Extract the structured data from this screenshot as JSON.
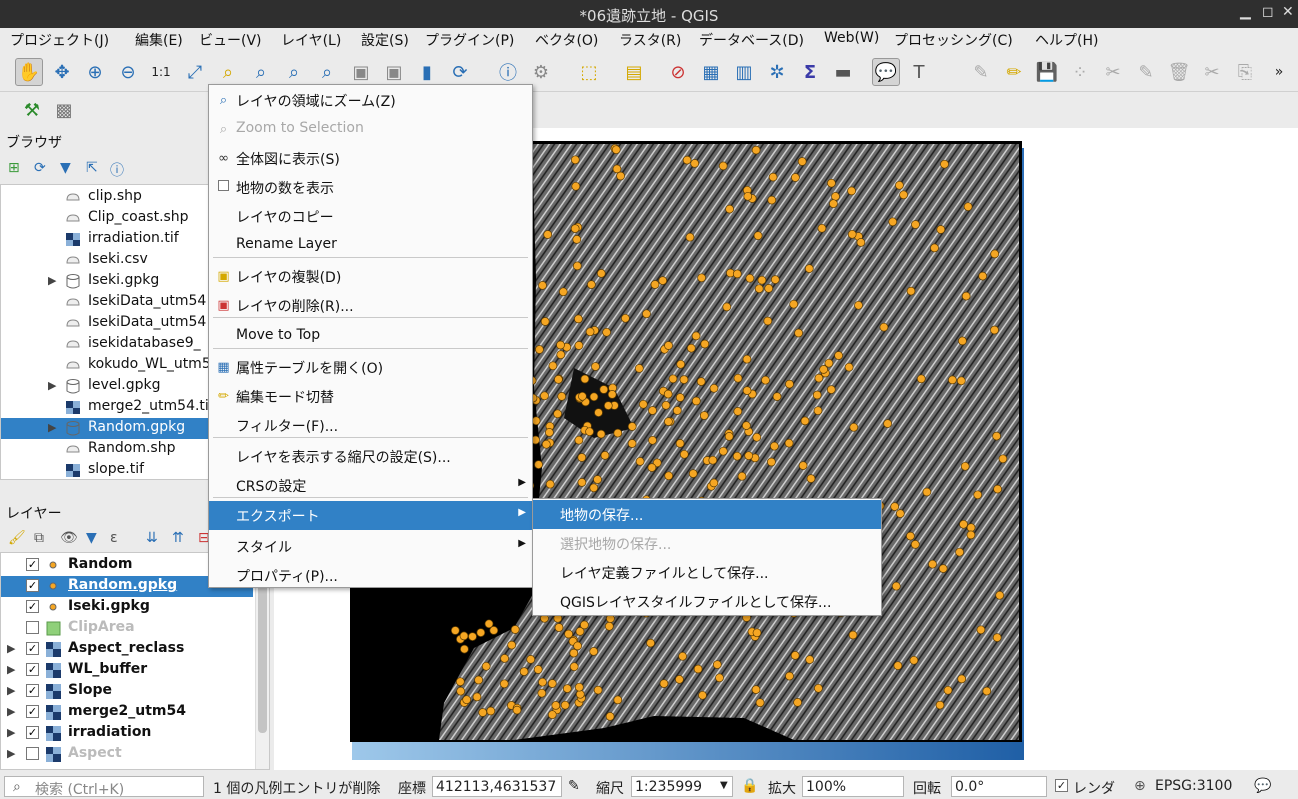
{
  "window": {
    "title": "*06遺跡立地 - QGIS"
  },
  "menu": [
    "プロジェクト(J)",
    "編集(E)",
    "ビュー(V)",
    "レイヤ(L)",
    "設定(S)",
    "プラグイン(P)",
    "ベクタ(O)",
    "ラスタ(R)",
    "データベース(D)",
    "Web(W)",
    "プロセッシング(C)",
    "ヘルプ(H)"
  ],
  "browser": {
    "title": "ブラウザ",
    "items": [
      {
        "label": "clip.shp",
        "icon": "vector-file-icon"
      },
      {
        "label": "Clip_coast.shp",
        "icon": "vector-file-icon"
      },
      {
        "label": "irradiation.tif",
        "icon": "raster-file-icon"
      },
      {
        "label": "Iseki.csv",
        "icon": "vector-file-icon"
      },
      {
        "label": "Iseki.gpkg",
        "icon": "geopackage-icon"
      },
      {
        "label": "IsekiData_utm54",
        "icon": "vector-file-icon"
      },
      {
        "label": "IsekiData_utm54",
        "icon": "vector-file-icon"
      },
      {
        "label": "isekidatabase9_",
        "icon": "vector-file-icon"
      },
      {
        "label": "kokudo_WL_utm5",
        "icon": "vector-file-icon"
      },
      {
        "label": "level.gpkg",
        "icon": "geopackage-icon"
      },
      {
        "label": "merge2_utm54.ti",
        "icon": "raster-file-icon"
      },
      {
        "label": "Random.gpkg",
        "icon": "geopackage-icon"
      },
      {
        "label": "Random.shp",
        "icon": "vector-file-icon"
      },
      {
        "label": "slope.tif",
        "icon": "raster-file-icon"
      }
    ]
  },
  "layers": {
    "title": "レイヤー",
    "items": [
      {
        "label": "Random",
        "checked": true
      },
      {
        "label": "Random.gpkg",
        "checked": true
      },
      {
        "label": "Iseki.gpkg",
        "checked": true
      },
      {
        "label": "ClipArea",
        "checked": false
      },
      {
        "label": "Aspect_reclass",
        "checked": true
      },
      {
        "label": "WL_buffer",
        "checked": true
      },
      {
        "label": "Slope",
        "checked": true
      },
      {
        "label": "merge2_utm54",
        "checked": true
      },
      {
        "label": "irradiation",
        "checked": true
      },
      {
        "label": "Aspect",
        "checked": false
      }
    ]
  },
  "context_menu": [
    {
      "label": "レイヤの領域にズーム(Z)",
      "icon": "zoom-layer-icon",
      "disabled": false
    },
    {
      "label": "Zoom to Selection",
      "icon": "zoom-selection-icon",
      "disabled": true
    },
    {
      "label": "全体図に表示(S)",
      "icon": "overview-icon",
      "disabled": false
    },
    {
      "label": "地物の数を表示",
      "icon": "checkbox-icon",
      "disabled": false
    },
    {
      "label": "レイヤのコピー",
      "icon": "",
      "disabled": false
    },
    {
      "label": "Rename Layer",
      "icon": "",
      "disabled": false
    },
    {
      "label": "レイヤの複製(D)",
      "icon": "duplicate-icon",
      "disabled": false
    },
    {
      "label": "レイヤの削除(R)...",
      "icon": "remove-layer-icon",
      "disabled": false
    },
    {
      "label": "Move to Top",
      "icon": "",
      "disabled": false
    },
    {
      "label": "属性テーブルを開く(O)",
      "icon": "table-icon",
      "disabled": false
    },
    {
      "label": "編集モード切替",
      "icon": "pencil-icon",
      "disabled": false
    },
    {
      "label": "フィルター(F)...",
      "icon": "",
      "disabled": false
    },
    {
      "label": "レイヤを表示する縮尺の設定(S)...",
      "icon": "",
      "disabled": false
    },
    {
      "label": "CRSの設定",
      "icon": "",
      "disabled": false,
      "submenu": true
    },
    {
      "label": "エクスポート",
      "icon": "",
      "disabled": false,
      "submenu": true,
      "highlighted": true
    },
    {
      "label": "スタイル",
      "icon": "",
      "disabled": false,
      "submenu": true
    },
    {
      "label": "プロパティ(P)...",
      "icon": "",
      "disabled": false
    }
  ],
  "export_submenu": [
    {
      "label": "地物の保存...",
      "highlighted": true,
      "disabled": false
    },
    {
      "label": "選択地物の保存...",
      "highlighted": false,
      "disabled": true
    },
    {
      "label": "レイヤ定義ファイルとして保存...",
      "highlighted": false,
      "disabled": false
    },
    {
      "label": "QGISレイヤスタイルファイルとして保存...",
      "highlighted": false,
      "disabled": false
    }
  ],
  "status": {
    "search_placeholder": "検索 (Ctrl+K)",
    "message": "1 個の凡例エントリが削除",
    "coord_label": "座標",
    "coord_value": "412113,4631537",
    "scale_label": "縮尺",
    "scale_value": "1:235999",
    "magnifier_label": "拡大",
    "magnifier_value": "100%",
    "rotation_label": "回転",
    "rotation_value": "0.0°",
    "render_label": "レンダ",
    "render_checked": true,
    "crs": "EPSG:3100"
  },
  "colors": {
    "accent": "#3181c6",
    "point": "#f5a623"
  }
}
